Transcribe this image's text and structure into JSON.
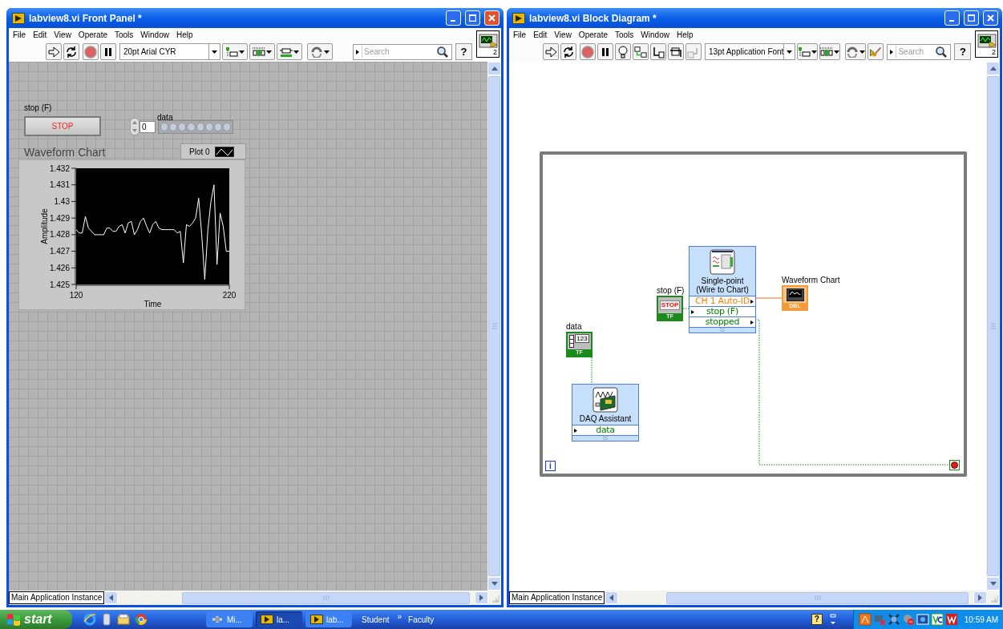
{
  "windows": [
    {
      "kind": "front_panel",
      "title": "labview8.vi Front Panel *",
      "active": true,
      "menu": [
        "File",
        "Edit",
        "View",
        "Operate",
        "Tools",
        "Window",
        "Help"
      ],
      "font": "20pt Arial CYR",
      "search_placeholder": "Search",
      "help": "?",
      "connector_count": "2",
      "status": "Main Application Instance",
      "panel": {
        "stop_label": "stop (F)",
        "stop_button": "STOP",
        "array_label": "data",
        "array_index": "0",
        "leds": [
          {
            "on": false
          },
          {
            "on": false
          },
          {
            "on": false
          },
          {
            "on": false
          },
          {
            "on": false
          },
          {
            "on": false
          },
          {
            "on": false
          },
          {
            "on": false
          }
        ],
        "chart": {
          "title": "Waveform Chart",
          "chart_data": {
            "type": "line",
            "xlabel": "Time",
            "ylabel": "Amplitude",
            "x": [
              120,
              122,
              124,
              126,
              128,
              130,
              132,
              134,
              136,
              138,
              140,
              142,
              144,
              146,
              148,
              150,
              152,
              154,
              156,
              158,
              160,
              162,
              164,
              166,
              168,
              170,
              172,
              174,
              176,
              178,
              180,
              182,
              184,
              186,
              188,
              190,
              192,
              194,
              196,
              198,
              200,
              202,
              204,
              206,
              208,
              210,
              212,
              214,
              216,
              218,
              220
            ],
            "series": [
              {
                "name": "Plot 0",
                "color": "#ffffff",
                "values": [
                  1.4283,
                  1.4281,
                  1.4281,
                  1.4291,
                  1.4284,
                  1.4282,
                  1.428,
                  1.428,
                  1.428,
                  1.428,
                  1.4284,
                  1.4284,
                  1.4282,
                  1.4282,
                  1.4285,
                  1.4286,
                  1.4281,
                  1.4287,
                  1.4288,
                  1.428,
                  1.4283,
                  1.4288,
                  1.429,
                  1.4285,
                  1.4281,
                  1.4286,
                  1.4288,
                  1.4284,
                  1.4283,
                  1.4283,
                  1.4283,
                  1.4283,
                  1.4283,
                  1.4281,
                  1.4282,
                  1.4263,
                  1.4286,
                  1.4285,
                  1.4287,
                  1.429,
                  1.4302,
                  1.428,
                  1.4253,
                  1.4283,
                  1.43,
                  1.431,
                  1.4262,
                  1.4293,
                  1.4285,
                  1.427,
                  1.427
                ]
              }
            ],
            "xlim": [
              120,
              220
            ],
            "ylim": [
              1.425,
              1.432
            ],
            "xticks": [
              120,
              220
            ],
            "yticks": [
              {
                "value": 1.432,
                "label": "1.432"
              },
              {
                "value": 1.431,
                "label": "1.431"
              },
              {
                "value": 1.43,
                "label": "1.43"
              },
              {
                "value": 1.429,
                "label": "1.429"
              },
              {
                "value": 1.428,
                "label": "1.428"
              },
              {
                "value": 1.427,
                "label": "1.427"
              },
              {
                "value": 1.426,
                "label": "1.426"
              },
              {
                "value": 1.425,
                "label": "1.425"
              }
            ]
          }
        }
      }
    },
    {
      "kind": "block_diagram",
      "title": "labview8.vi Block Diagram *",
      "active": false,
      "menu": [
        "File",
        "Edit",
        "View",
        "Operate",
        "Tools",
        "Window",
        "Help"
      ],
      "font": "13pt Application Font",
      "search_placeholder": "Search",
      "help": "?",
      "connector_count": "2",
      "status": "Main Application Instance",
      "diagram": {
        "iteration": "i",
        "nodes": [
          {
            "kind": "array_terminal",
            "label": "data",
            "icon_text": "123",
            "type": "TF"
          },
          {
            "kind": "express",
            "label": "DAQ Assistant",
            "rows": [
              {
                "text": "data",
                "color": "#008000",
                "output": false
              }
            ]
          },
          {
            "kind": "stop_terminal",
            "label": "stop (F)",
            "icon_text": "STOP",
            "type": "TF"
          },
          {
            "kind": "express",
            "label": "Single-point (Wire to Chart)",
            "rows": [
              {
                "text": "CH 1 Auto-ID",
                "color": "#ff8000",
                "output": true
              },
              {
                "text": "stop (F)",
                "color": "#008000",
                "output": false
              },
              {
                "text": "stopped",
                "color": "#008000",
                "output": true
              }
            ]
          },
          {
            "kind": "chart_terminal",
            "label": "Waveform Chart",
            "type": "DBL"
          }
        ]
      }
    }
  ],
  "taskbar": {
    "start": "start",
    "tasks": [
      {
        "label": "Mi...",
        "selected": false
      },
      {
        "label": "la...",
        "selected": true
      },
      {
        "label": "lab...",
        "selected": false
      }
    ],
    "links": [
      "Student",
      "Faculty"
    ],
    "chevron": "»",
    "help": "?",
    "clock": "10:59 AM"
  }
}
